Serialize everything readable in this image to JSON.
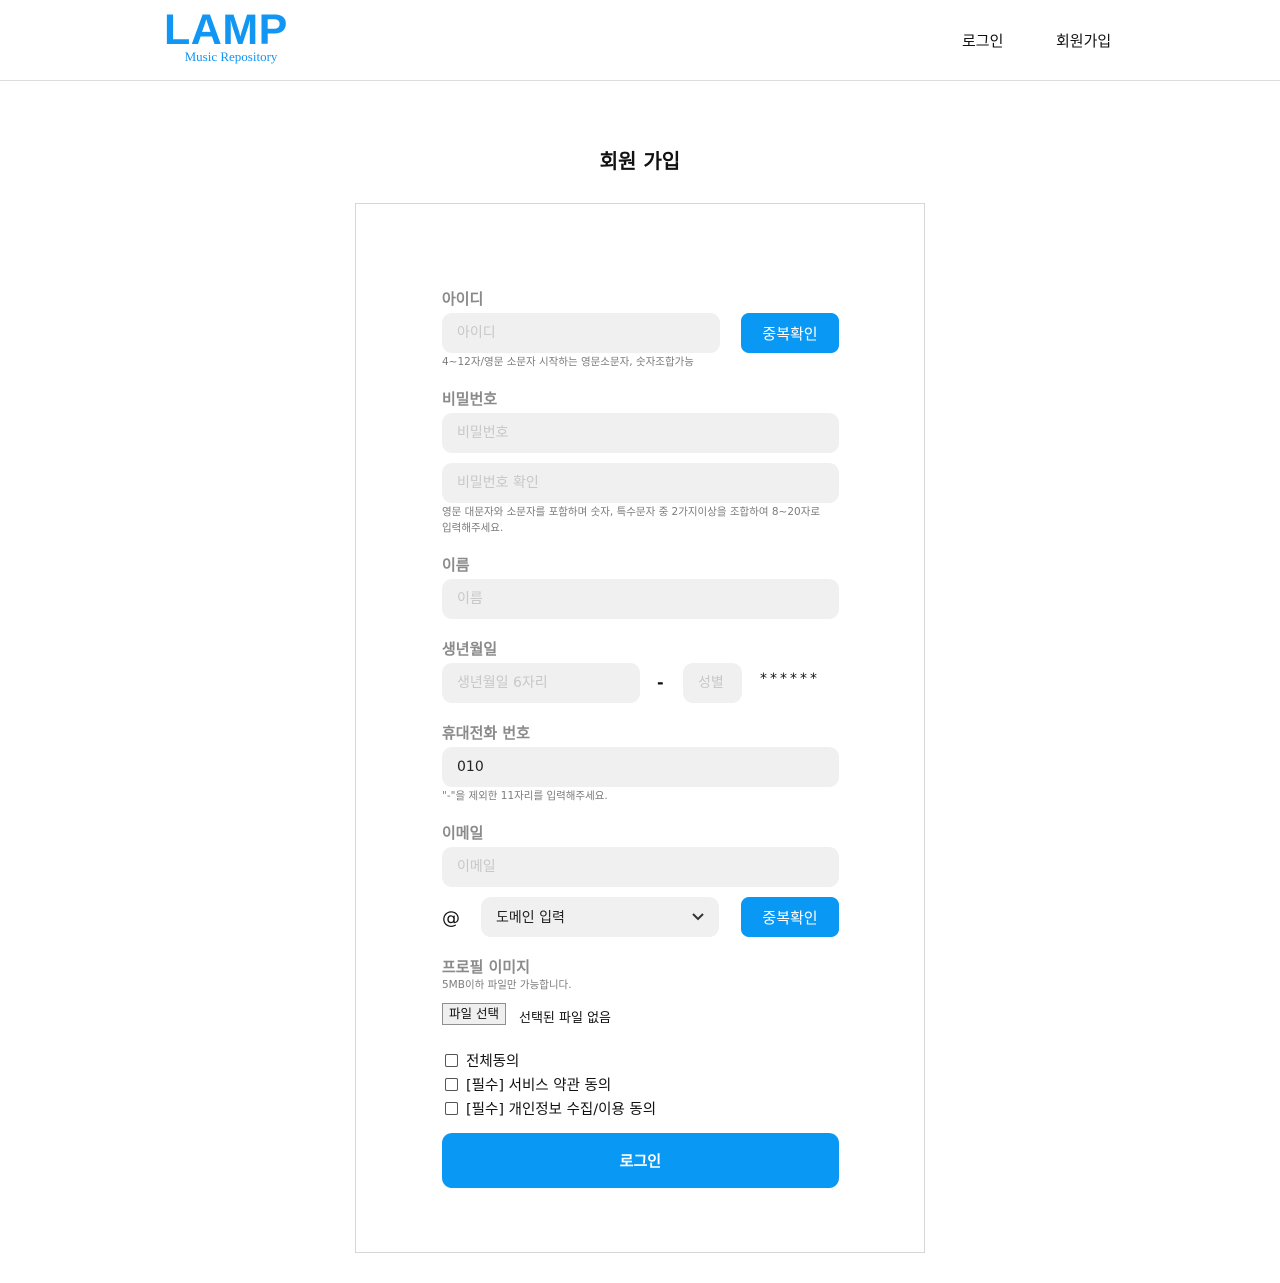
{
  "header": {
    "logo_main": "LAMP",
    "logo_sub": "Music Repository",
    "nav_login": "로그인",
    "nav_join": "회원가입"
  },
  "page": {
    "title": "회원 가입"
  },
  "form": {
    "id": {
      "label": "아이디",
      "placeholder": "아이디",
      "check_button": "중복확인",
      "hint": "4~12자/영문 소문자 시작하는 영문소문자, 숫자조합가능"
    },
    "password": {
      "label": "비밀번호",
      "placeholder": "비밀번호",
      "confirm_placeholder": "비밀번호 확인",
      "hint_line1": "영문 대문자와 소문자를 포함하며 숫자, 특수문자 중 2가지이상을 조합하여 8~20자로",
      "hint_line2": "입력해주세요."
    },
    "name": {
      "label": "이름",
      "placeholder": "이름"
    },
    "birth": {
      "label": "생년월일",
      "date_placeholder": "생년월일 6자리",
      "dash": "-",
      "gender_placeholder": "성별",
      "mask": "******"
    },
    "phone": {
      "label": "휴대전화 번호",
      "value": "010",
      "hint": "\"-\"을 제외한 11자리를 입력해주세요."
    },
    "email": {
      "label": "이메일",
      "placeholder": "이메일",
      "at": "@",
      "domain_selected": "도메인 입력",
      "check_button": "중복확인"
    },
    "profile": {
      "label": "프로필 이미지",
      "hint": "5MB이하 파일만 가능합니다.",
      "file_button": "파일 선택",
      "file_status": "선택된 파일 없음"
    },
    "agreements": [
      {
        "label": "전체동의",
        "checked": false
      },
      {
        "label": "[필수] 서비스 약관 동의",
        "checked": false
      },
      {
        "label": "[필수] 개인정보 수집/이용 동의",
        "checked": false
      }
    ],
    "submit_label": "로그인"
  },
  "colors": {
    "accent": "#0a98f5",
    "input_bg": "#f0f0f0",
    "label": "#8a8a8a"
  }
}
